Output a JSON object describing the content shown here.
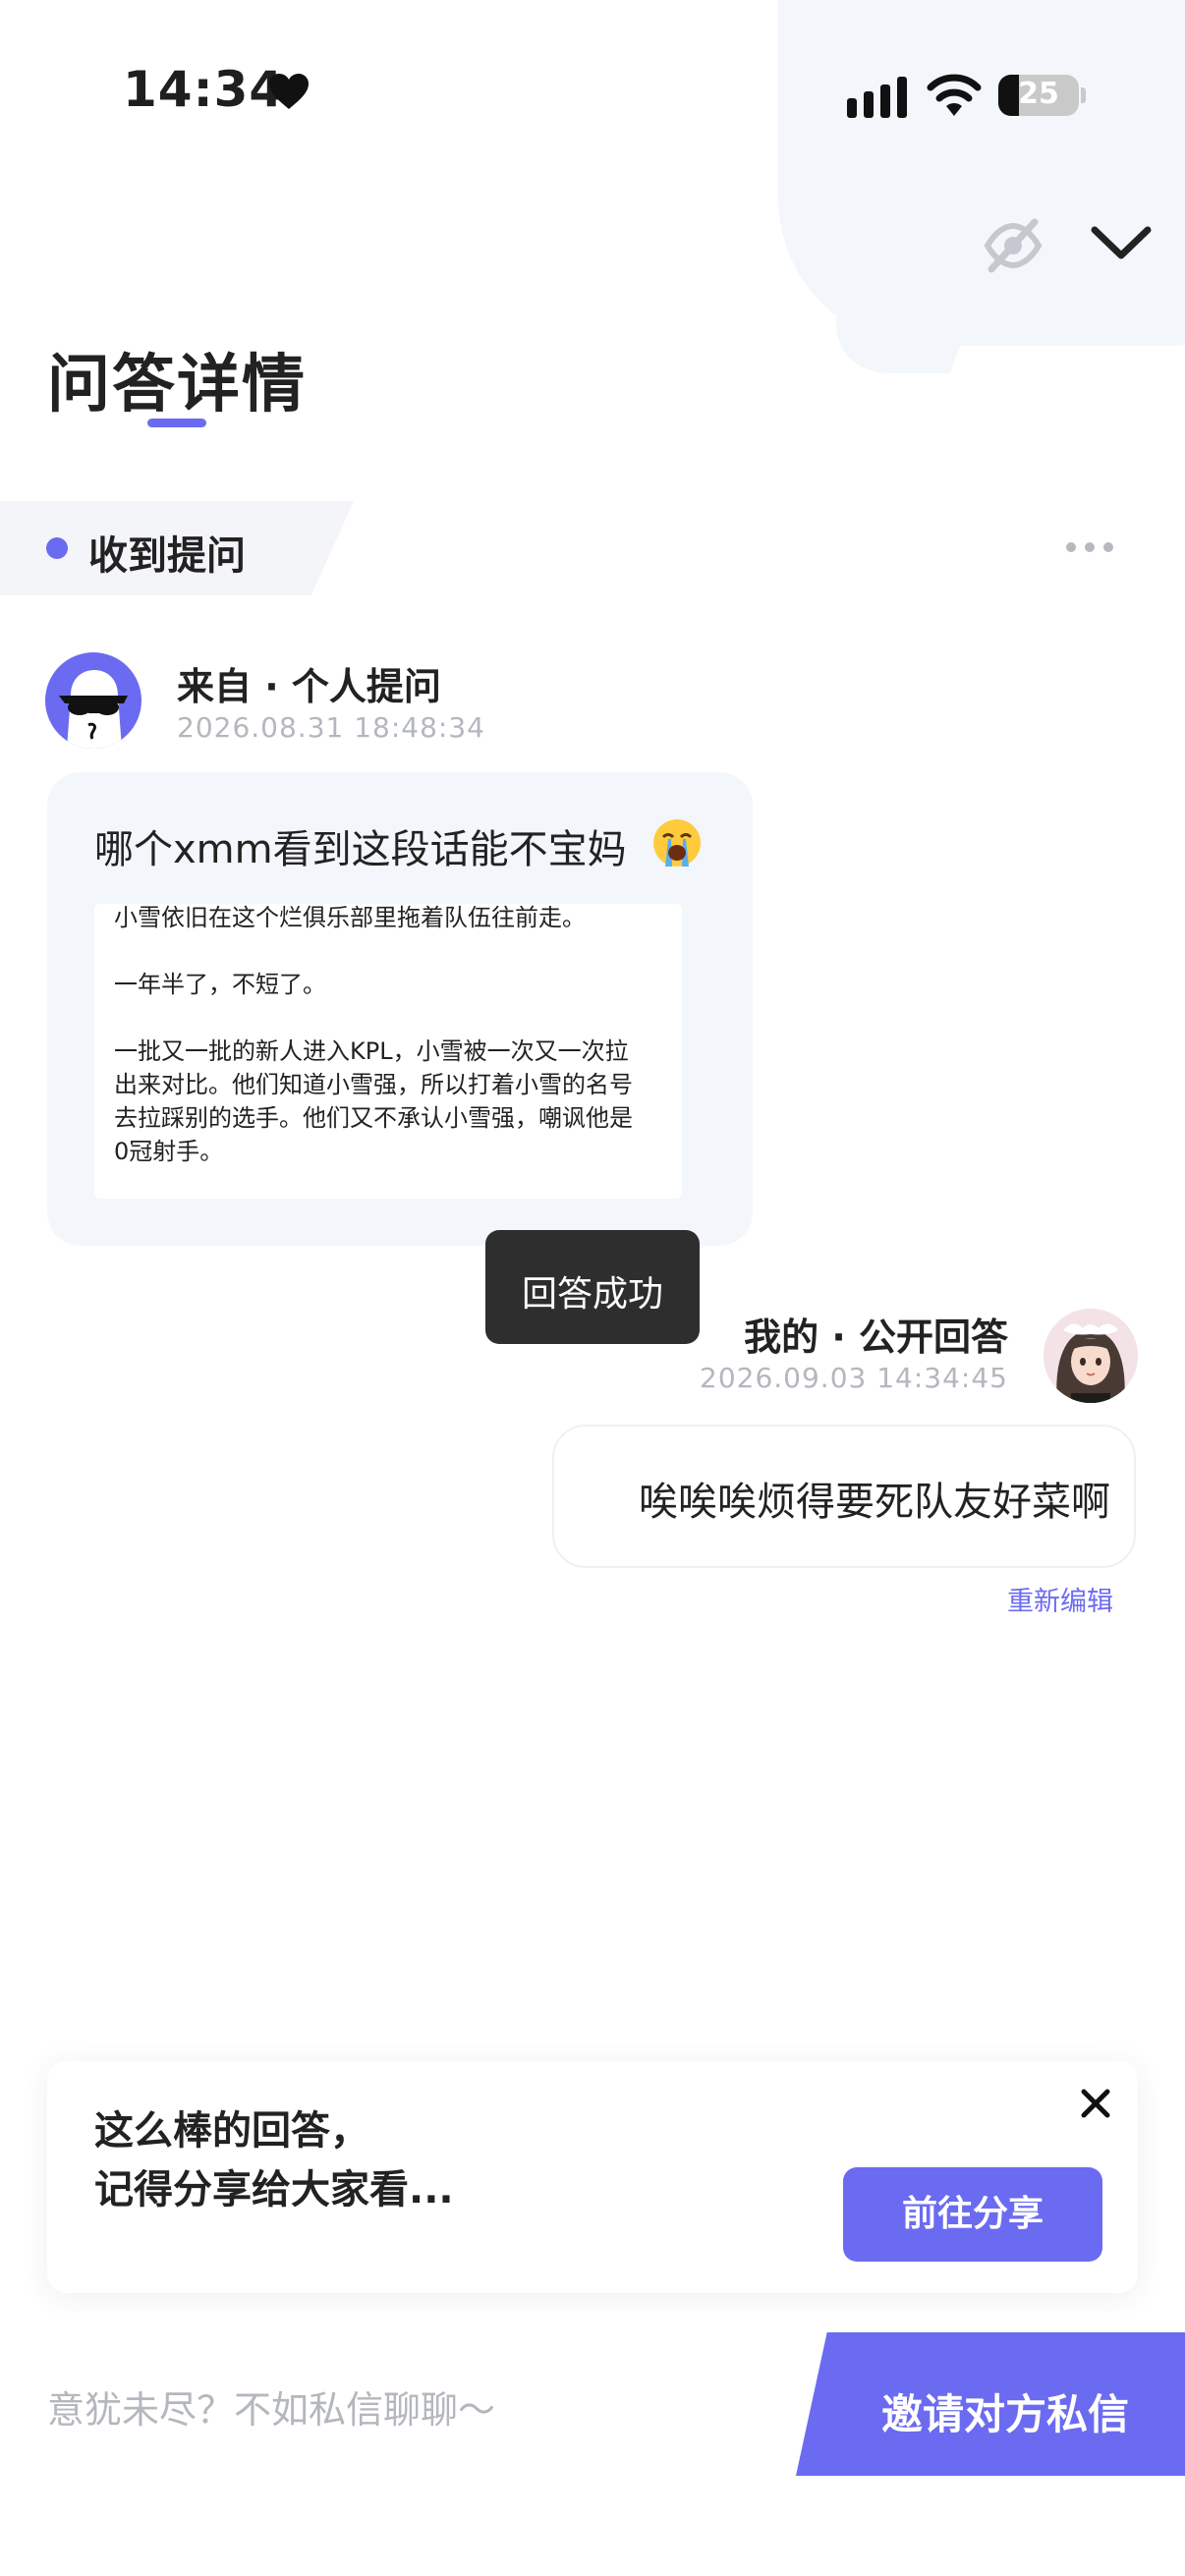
{
  "status_bar": {
    "time": "14:34",
    "battery": "25",
    "battery_level_percent": 25
  },
  "header": {
    "title": "问答详情",
    "actions": [
      "eye-off-icon",
      "chevron-down-icon"
    ]
  },
  "section": {
    "label": "收到提问",
    "more_icon": "more-dots-icon"
  },
  "question": {
    "sender": "来自 · 个人提问",
    "time": "2026.08.31 18:48:34",
    "text": "哪个xmm看到这段话能不宝妈",
    "emoji": "loudly-crying-emoji",
    "quote_lines": [
      "小雪依旧在这个烂俱乐部里拖着队伍往前走。",
      "",
      "一年半了，不短了。",
      "",
      "一批又一批的新人进入KPL，小雪被一次又一次拉",
      "出来对比。他们知道小雪强，所以打着小雪的名号",
      "去拉踩别的选手。他们又不承认小雪强，嘲讽他是",
      "0冠射手。"
    ]
  },
  "toast": {
    "text": "回答成功"
  },
  "answer": {
    "sender": "我的 · 公开回答",
    "time": "2026.09.03 14:34:45",
    "text": "唉唉唉烦得要死队友好菜啊",
    "reedit": "重新编辑"
  },
  "share_card": {
    "line1": "这么棒的回答，",
    "line2": "记得分享给大家看...",
    "button": "前往分享",
    "close_icon": "close-icon"
  },
  "bottom_bar": {
    "hint": "意犹未尽？不如私信聊聊～",
    "invite": "邀请对方私信"
  },
  "colors": {
    "accent": "#6b6bf1",
    "bubble_bg": "#f3f6fb",
    "toast_bg": "#2e2e2e",
    "muted_text": "#b4b7bd"
  }
}
